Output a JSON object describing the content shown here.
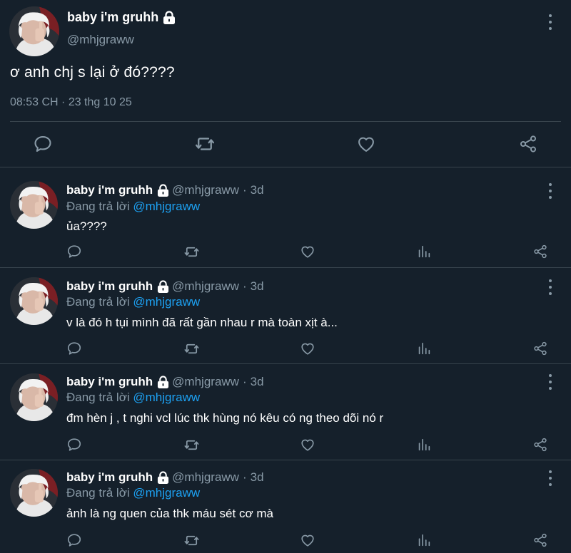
{
  "main_tweet": {
    "display_name": "baby i'm gruhh",
    "handle": "@mhjgraww",
    "text": "ơ anh chj s lại ở đó????",
    "timestamp": "08:53 CH · 23 thg 10 25",
    "icons": [
      "reply-icon",
      "retweet-icon",
      "like-icon",
      "share-icon",
      "more-icon",
      "lock-icon"
    ]
  },
  "replies": [
    {
      "display_name": "baby i'm gruhh",
      "handle": "@mhjgraww",
      "separator": "·",
      "time": "3d",
      "replying_prefix": "Đang trả lời",
      "replying_mention": "@mhjgraww",
      "text": "ủa????"
    },
    {
      "display_name": "baby i'm gruhh",
      "handle": "@mhjgraww",
      "separator": "·",
      "time": "3d",
      "replying_prefix": "Đang trả lời",
      "replying_mention": "@mhjgraww",
      "text": "v là đó h tụi mình đã rất gần nhau r mà toàn xịt à..."
    },
    {
      "display_name": "baby i'm gruhh",
      "handle": "@mhjgraww",
      "separator": "·",
      "time": "3d",
      "replying_prefix": "Đang trả lời",
      "replying_mention": "@mhjgraww",
      "text": "đm hèn j , t nghi vcl lúc thk hùng nó kêu có ng theo dõi nó r"
    },
    {
      "display_name": "baby i'm gruhh",
      "handle": "@mhjgraww",
      "separator": "·",
      "time": "3d",
      "replying_prefix": "Đang trả lời",
      "replying_mention": "@mhjgraww",
      "text": "ảnh là ng quen của thk máu sét cơ mà"
    }
  ],
  "colors": {
    "background": "#15202b",
    "divider": "#38444d",
    "secondary_text": "#8899a6",
    "mention": "#1da1f2",
    "primary_text": "#ffffff"
  }
}
